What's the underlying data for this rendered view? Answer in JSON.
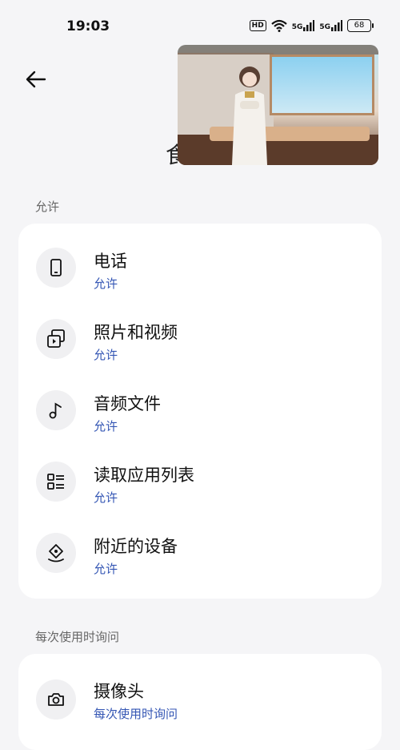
{
  "status_bar": {
    "time": "19:03",
    "hd_label": "HD",
    "signal1_label": "5G",
    "signal2_label": "5G",
    "battery": "68"
  },
  "header": {
    "partial_title": "食"
  },
  "sections": [
    {
      "label": "允许",
      "items": [
        {
          "title": "电话",
          "status": "允许",
          "icon": "phone-icon"
        },
        {
          "title": "照片和视频",
          "status": "允许",
          "icon": "photos-videos-icon"
        },
        {
          "title": "音频文件",
          "status": "允许",
          "icon": "music-note-icon"
        },
        {
          "title": "读取应用列表",
          "status": "允许",
          "icon": "app-list-icon"
        },
        {
          "title": "附近的设备",
          "status": "允许",
          "icon": "nearby-devices-icon"
        }
      ]
    },
    {
      "label": "每次使用时询问",
      "items": [
        {
          "title": "摄像头",
          "status": "每次使用时询问",
          "icon": "camera-icon"
        }
      ]
    }
  ],
  "colors": {
    "background": "#f5f5f7",
    "card": "#ffffff",
    "status_text": "#3456b4",
    "icon_bg": "#f0f0f2"
  }
}
